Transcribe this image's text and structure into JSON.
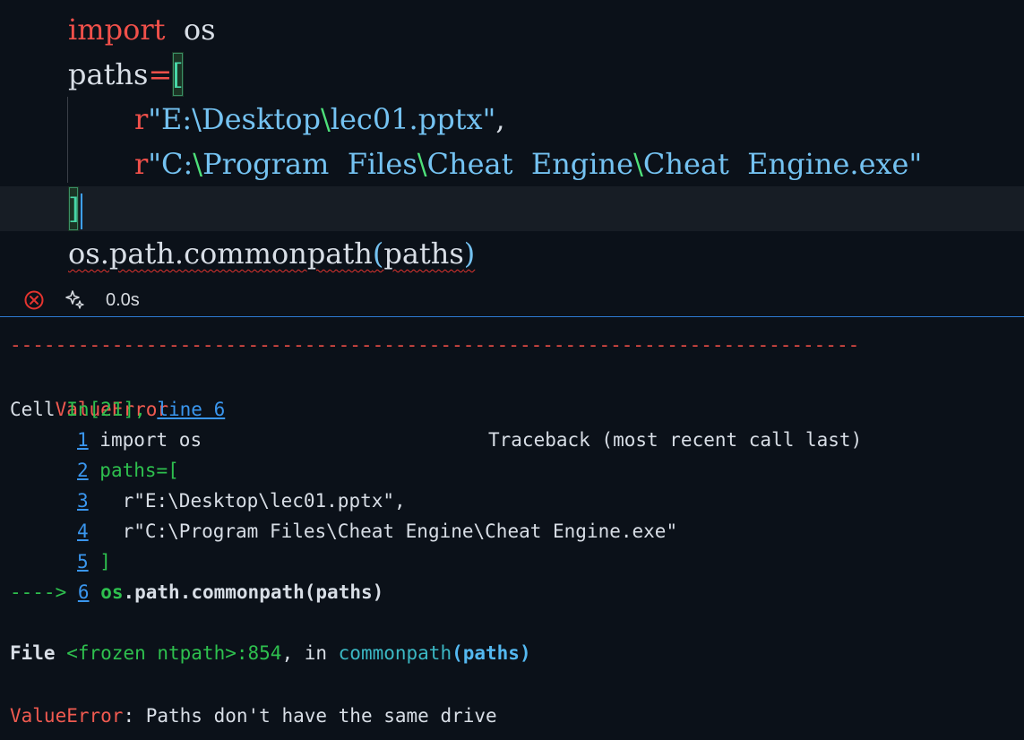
{
  "code": {
    "line1": {
      "keyword": "import",
      "module": "os"
    },
    "line2": {
      "name": "paths",
      "op": "=",
      "bracket": "["
    },
    "line3": {
      "prefix": "r",
      "quote_open": "\"",
      "p1": "E:",
      "sep1": "\\",
      "p2": "Desktop",
      "sep2": "\\",
      "p3": "lec01.pptx",
      "quote_close": "\"",
      "comma": ","
    },
    "line4": {
      "prefix": "r",
      "quote_open": "\"",
      "p1": "C:",
      "sep1": "\\",
      "p2": "Program  Files",
      "sep2": "\\",
      "p3": "Cheat  Engine",
      "sep3": "\\",
      "p4": "Cheat  Engine.exe",
      "quote_close": "\""
    },
    "line5": {
      "bracket": "]"
    },
    "line6": {
      "call": "os.path.commonpath",
      "paren_open": "(",
      "arg": "paths",
      "paren_close": ")"
    }
  },
  "status": {
    "error_icon": "error-circle-icon",
    "spark_icon": "sparkle-icon",
    "exec_time": "0.0s"
  },
  "output": {
    "dashes": "---------------------------------------------------------------------------",
    "error_name": "ValueError",
    "traceback_header": "Traceback (most recent call last)",
    "cell_label": "Cell ",
    "cell_ref": "In[21], ",
    "line_link": "line 6",
    "src": [
      {
        "num": "1",
        "text": " import os"
      },
      {
        "num": "2",
        "text": " paths=["
      },
      {
        "num": "3",
        "text": "   r\"E:\\Desktop\\lec01.pptx\","
      },
      {
        "num": "4",
        "text": "   r\"C:\\Program Files\\Cheat Engine\\Cheat Engine.exe\""
      },
      {
        "num": "5",
        "text": " ]"
      }
    ],
    "arrow": "---->",
    "arrow_num": "6",
    "arrow_code_mod": "os",
    "arrow_code_rest": ".path.commonpath(paths)",
    "file_label": "File ",
    "file_ref": "<frozen ntpath>:854",
    "file_in": ", in ",
    "file_func": "commonpath",
    "file_args": "(paths)",
    "final_error": "ValueError",
    "final_message": ": Paths don't have the same drive"
  },
  "colors": {
    "background": "#0b1119",
    "keyword": "#f0504a",
    "string": "#74c2f1",
    "escape": "#4ee07a",
    "error_red": "#f05a50",
    "link_blue": "#3a96ee",
    "cell_green": "#2ec04e",
    "divider_blue": "#2d7bd2"
  }
}
